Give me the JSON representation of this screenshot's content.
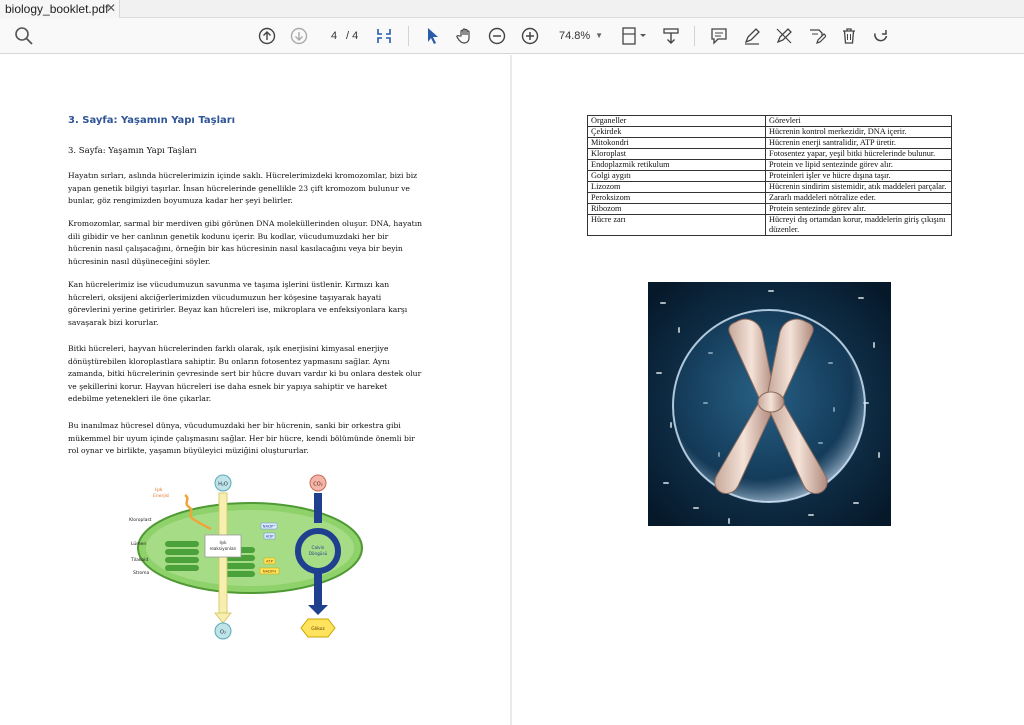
{
  "tab": {
    "title": "biology_booklet.pdf"
  },
  "toolbar": {
    "page_current": "4",
    "page_total": "/ 4",
    "zoom": "74.8%"
  },
  "page_left": {
    "heading": "3. Sayfa: Yaşamın Yapı Taşları",
    "subheading": "3. Sayfa: Yaşamın Yapı Taşları",
    "paragraphs": [
      {
        "lines": [
          "Hayatın sırları, aslında hücrelerimizin içinde saklı. Hücrelerimizdeki kromozomlar, bizi biz",
          "yapan genetik bilgiyi taşırlar. İnsan hücrelerinde genellikle 23 çift kromozom bulunur ve",
          "bunlar, göz rengimizden boyumuza kadar her şeyi belirler."
        ]
      },
      {
        "lines": [
          "Kromozomlar, sarmal bir merdiven gibi görünen DNA moleküllerinden oluşur. DNA, hayatın",
          "dili gibidir ve her canlının genetik kodunu içerir. Bu kodlar, vücudumuzdaki her bir",
          "hücrenin nasıl çalışacağını, örneğin bir kas hücresinin nasıl kasılacağını veya bir beyin",
          "hücresinin nasıl düşüneceğini söyler."
        ]
      },
      {
        "lines": [
          "Kan hücrelerimiz ise vücudumuzun savunma ve taşıma işlerini üstlenir. Kırmızı kan",
          "hücreleri, oksijeni akciğerlerimizden vücudumuzun her köşesine taşıyarak hayati",
          "görevlerini yerine getirirler. Beyaz kan hücreleri ise, mikroplara ve enfeksiyonlara karşı",
          "savaşarak bizi korurlar."
        ]
      },
      {
        "lines": [
          "Bitki hücreleri, hayvan hücrelerinden farklı olarak, ışık enerjisini kimyasal enerjiye",
          "dönüştürebilen kloroplastlara sahiptir. Bu onların fotosentez yapmasını sağlar. Aynı",
          "zamanda, bitki hücrelerinin çevresinde sert bir hücre duvarı vardır ki bu onlara destek olur",
          "ve şekillerini korur. Hayvan hücreleri ise daha esnek bir yapıya sahiptir ve hareket",
          "edebilme yetenekleri ile öne çıkarlar."
        ]
      },
      {
        "lines": [
          "Bu inanılmaz hücresel dünya, vücudumuzdaki her bir hücrenin, sanki bir orkestra gibi",
          "mükemmel bir uyum içinde çalışmasını sağlar. Her bir hücre, kendi bölümünde önemli bir",
          "rol oynar ve birlikte, yaşamın büyüleyici müziğini oluştururlar."
        ]
      }
    ],
    "diagram": {
      "light_label_1": "Işık",
      "light_label_2": "Enerjisi",
      "h2o": "H₂O",
      "co2": "CO₂",
      "o2": "O₂",
      "chloroplast": "Kloroplast",
      "lumen": "Lümen",
      "thylakoid": "Tilakoid",
      "stroma": "Stroma",
      "light_reactions_1": "Işık",
      "light_reactions_2": "reaksiyonları",
      "nadp": "NADP⁺",
      "adp": "ADP",
      "atp": "ATP",
      "nadph": "NADPH",
      "calvin_1": "Calvin",
      "calvin_2": "Döngüsü",
      "glucose": "Glikoz"
    }
  },
  "page_right": {
    "table": {
      "headers": [
        "Organeller",
        "Görevleri"
      ],
      "rows": [
        [
          "Çekirdek",
          "Hücrenin kontrol merkezidir, DNA içerir."
        ],
        [
          "Mitokondri",
          "Hücrenin enerji santralidir, ATP üretir."
        ],
        [
          "Kloroplast",
          "Fotosentez yapar, yeşil bitki hücrelerinde bulunur."
        ],
        [
          "Endoplazmik retikulum",
          "Protein ve lipid sentezinde görev alır."
        ],
        [
          "Golgi aygıtı",
          "Proteinleri işler ve hücre dışına taşır."
        ],
        [
          "Lizozom",
          "Hücrenin sindirim sistemidir, atık maddeleri parçalar."
        ],
        [
          "Peroksizom",
          "Zararlı maddeleri nötralize eder."
        ],
        [
          "Ribozom",
          "Protein sentezinde görev alır."
        ],
        [
          "Hücre zarı",
          "Hücreyi dış ortamdan korur, maddelerin giriş çıkışını düzenler."
        ]
      ]
    }
  },
  "colors": {
    "heading_blue": "#2f5597",
    "chloroplast_green": "#6cc24a",
    "arrow_blue": "#1f3f8f",
    "image_bg": "#0e2a44"
  }
}
